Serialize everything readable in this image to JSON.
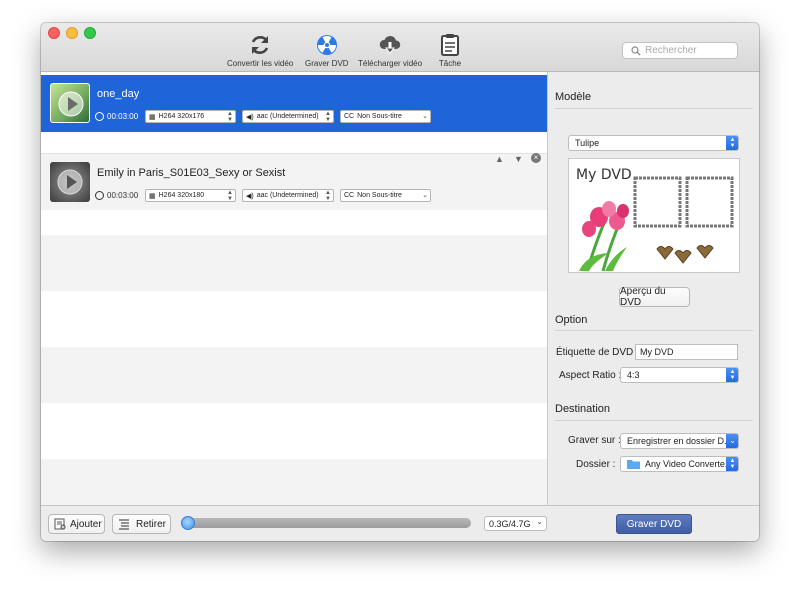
{
  "toolbar": {
    "convert_label": "Convertir les vidéo",
    "burn_label": "Graver DVD",
    "download_label": "Télécharger vidéo",
    "task_label": "Tâche"
  },
  "search": {
    "placeholder": "Rechercher"
  },
  "files": [
    {
      "name": "one_day",
      "duration": "00:03:00",
      "video": "H264 320x176",
      "audio": "aac (Undetermined)",
      "subtitle": "Non Sous-titre",
      "selected": true
    },
    {
      "name": "Emily in Paris_S01E03_Sexy or Sexist",
      "duration": "00:03:00",
      "video": "H264 320x180",
      "audio": "aac (Undetermined)",
      "subtitle": "Non Sous-titre",
      "selected": false
    }
  ],
  "cc_label": "CC",
  "panel": {
    "model_title": "Modèle",
    "template_value": "Tulipe",
    "preview_text": "My DVD",
    "preview_button": "Aperçu du DVD",
    "option_title": "Option",
    "dvd_label_label": "Étiquette de DVD :",
    "dvd_label_value": "My DVD",
    "aspect_label": "Aspect Ratio :",
    "aspect_value": "4:3",
    "destination_title": "Destination",
    "burn_to_label": "Graver sur :",
    "burn_to_value": "Enregistrer en dossier D...",
    "folder_label": "Dossier  :",
    "folder_value": "Any Video Converte..."
  },
  "bottom": {
    "add_label": "Ajouter",
    "remove_label": "Retirer",
    "progress": 0.0,
    "size_value": "0.3G/4.7G",
    "burn_button": "Graver DVD"
  }
}
